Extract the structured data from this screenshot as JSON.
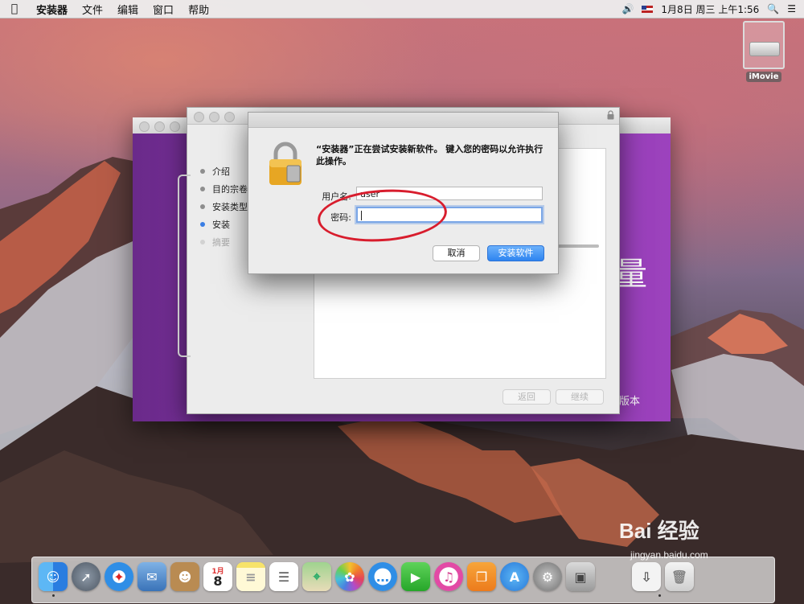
{
  "menubar": {
    "app_name": "安装器",
    "items": [
      "文件",
      "编辑",
      "窗口",
      "帮助"
    ],
    "clock": "1月8日 周三 上午1:56"
  },
  "desktop": {
    "disk_label": "iMovie"
  },
  "purple_window": {
    "big_char": "量",
    "version_text": "版本"
  },
  "installer": {
    "steps": [
      {
        "label": "介绍",
        "state": "done"
      },
      {
        "label": "目的宗卷",
        "state": "done"
      },
      {
        "label": "安装类型",
        "state": "done"
      },
      {
        "label": "安装",
        "state": "active"
      },
      {
        "label": "摘要",
        "state": "pending"
      }
    ],
    "back_label": "返回",
    "continue_label": "继续"
  },
  "auth_dialog": {
    "message": "“安装器”正在尝试安装新软件。 键入您的密码以允许执行此操作。",
    "username_label": "用户名:",
    "username_value": "user",
    "password_label": "密码:",
    "password_value": "",
    "cancel_label": "取消",
    "install_label": "安装软件"
  },
  "dock": {
    "calendar_month": "1月",
    "calendar_day": "8",
    "apps": [
      "finder-icon",
      "launchpad-icon",
      "safari-icon",
      "mail-icon",
      "contacts-icon",
      "calendar-icon",
      "notes-icon",
      "reminders-icon",
      "maps-icon",
      "photos-icon",
      "messages-icon",
      "facetime-icon",
      "itunes-icon",
      "ibooks-icon",
      "app-store-icon",
      "system-preferences-icon",
      "installer-icon",
      "downloads-icon",
      "trash-icon"
    ]
  },
  "watermark": {
    "text": "Bai 经验",
    "url": "jingyan.baidu.com"
  },
  "colors": {
    "accent_blue": "#2e84f0",
    "annotation_red": "#d81d2d",
    "installer_purple": "#8a37ad"
  }
}
